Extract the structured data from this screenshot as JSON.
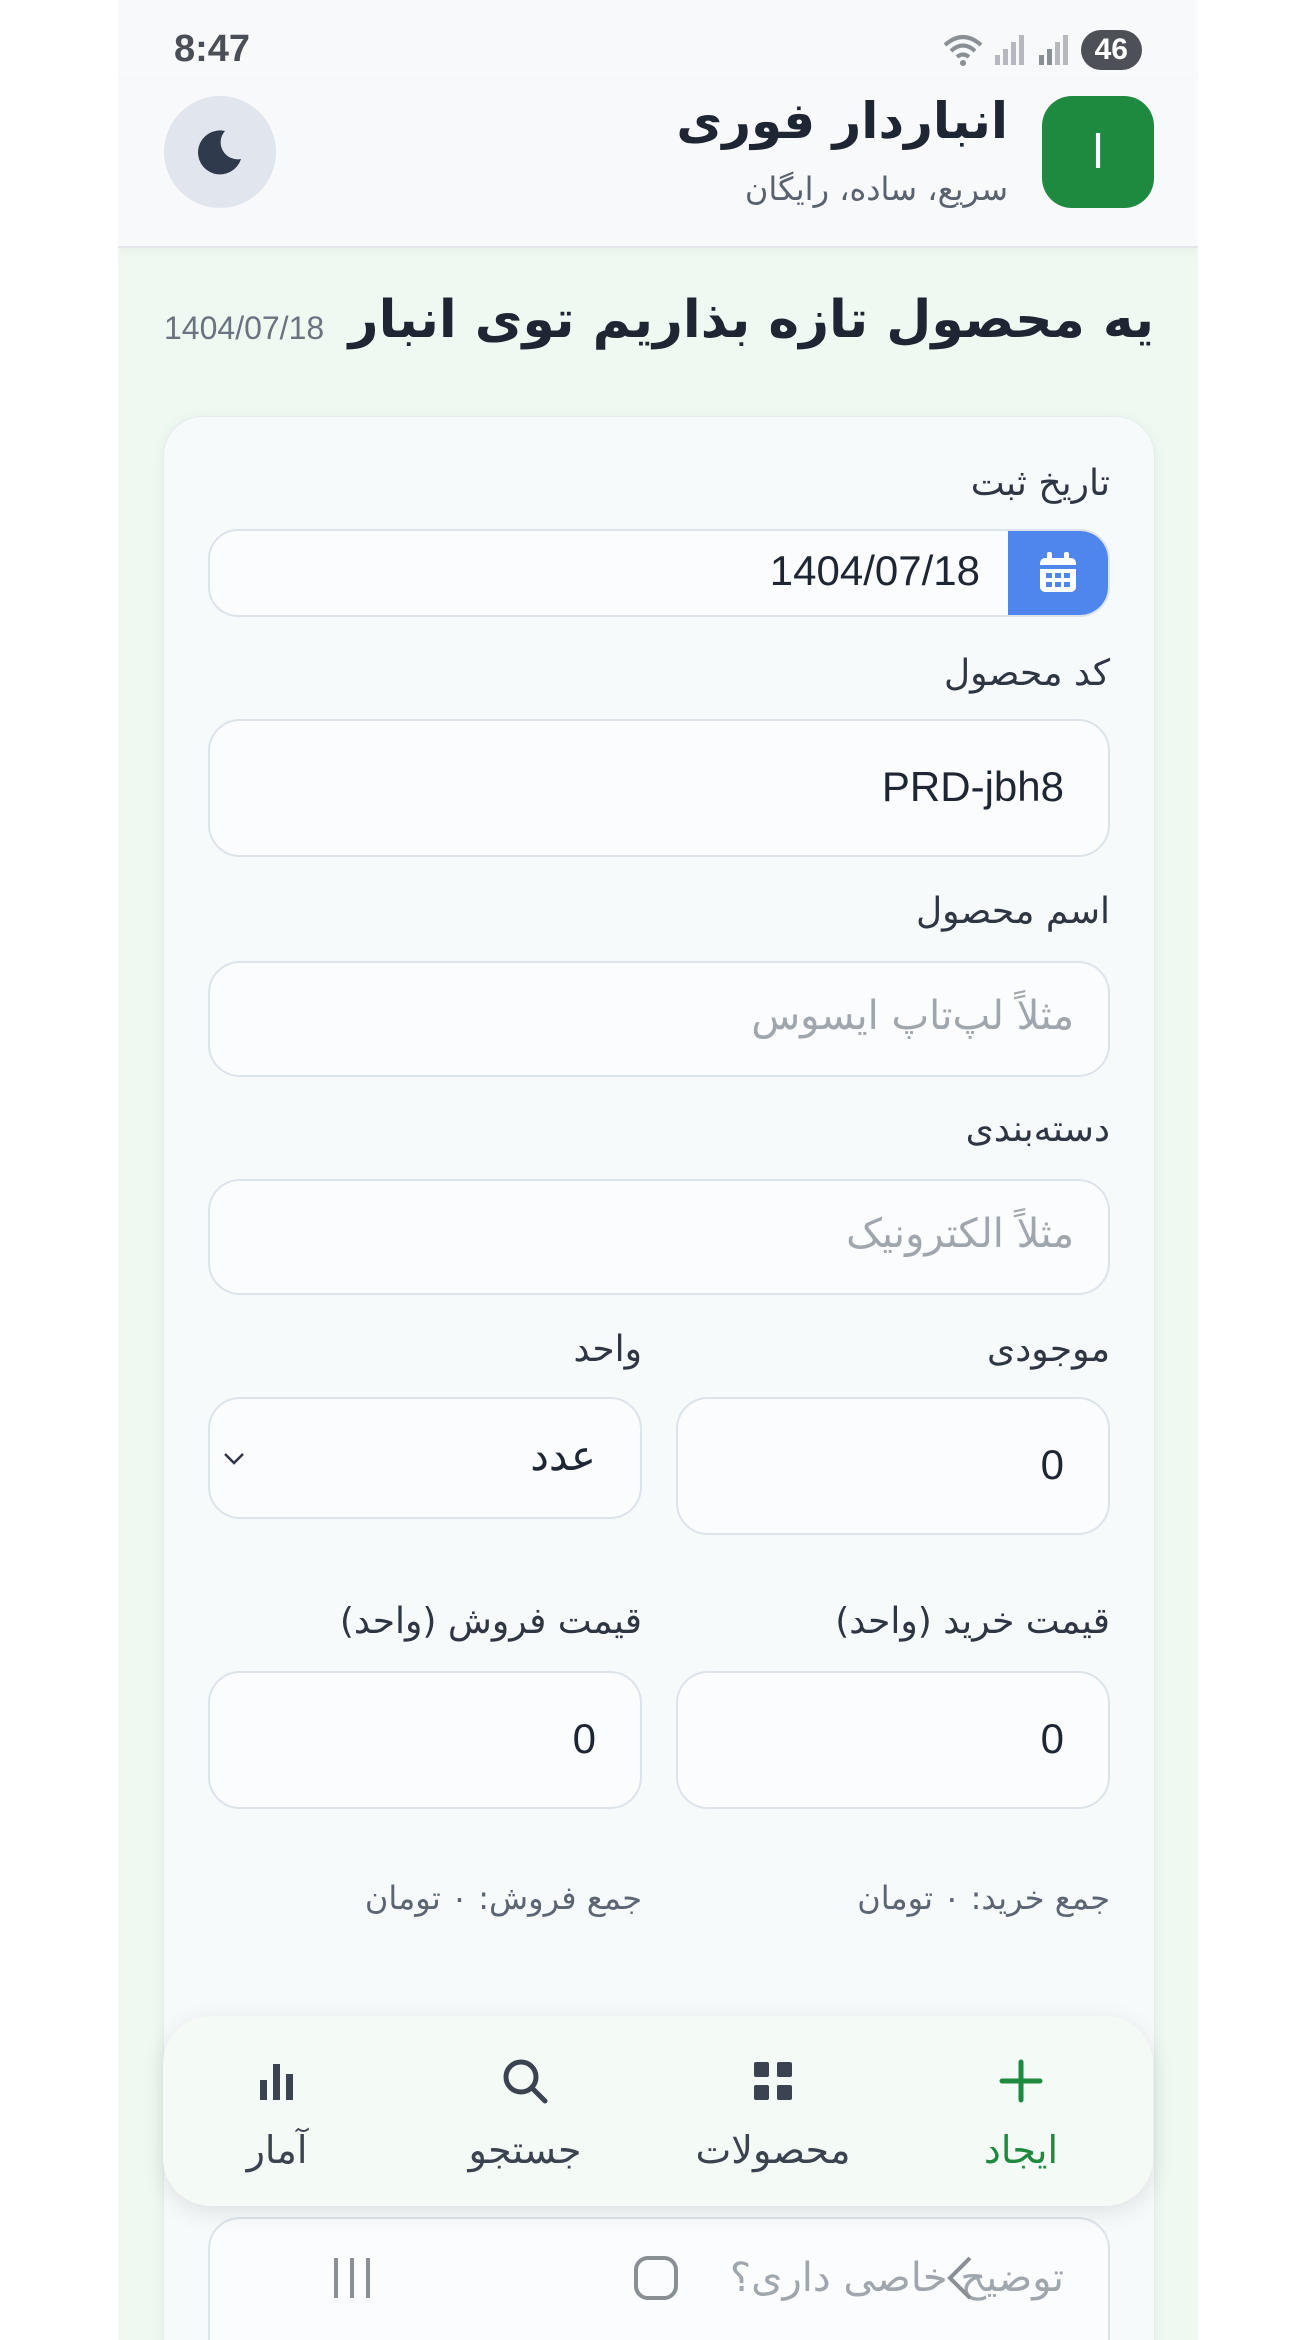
{
  "status_bar": {
    "time": "8:47",
    "battery": "46"
  },
  "header": {
    "logo_letter": "ا",
    "title": "انباردار فوری",
    "subtitle": "سریع، ساده، رایگان"
  },
  "page": {
    "title": "یه محصول تازه بذاریم توی انبار",
    "date": "1404/07/18"
  },
  "form": {
    "date_label": "تاریخ ثبت",
    "date_value": "1404/07/18",
    "code_label": "کد محصول",
    "code_value": "PRD-jbh8",
    "name_label": "اسم محصول",
    "name_placeholder": "مثلاً لپ‌تاپ ایسوس",
    "category_label": "دسته‌بندی",
    "category_placeholder": "مثلاً الکترونیک",
    "stock_label": "موجودی",
    "stock_value": "0",
    "unit_label": "واحد",
    "unit_value": "عدد",
    "buy_price_label": "قیمت خرید (واحد)",
    "buy_price_value": "0",
    "sell_price_label": "قیمت فروش (واحد)",
    "sell_price_value": "0",
    "buy_total": "جمع خرید: ۰ تومان",
    "sell_total": "جمع فروش: ۰ تومان",
    "description_placeholder": "توضیح خاصی داری؟"
  },
  "nav": {
    "create": "ایجاد",
    "products": "محصولات",
    "search": "جستجو",
    "stats": "آمار"
  },
  "colors": {
    "brand": "#1e8a3f",
    "accent": "#4f86ee"
  }
}
